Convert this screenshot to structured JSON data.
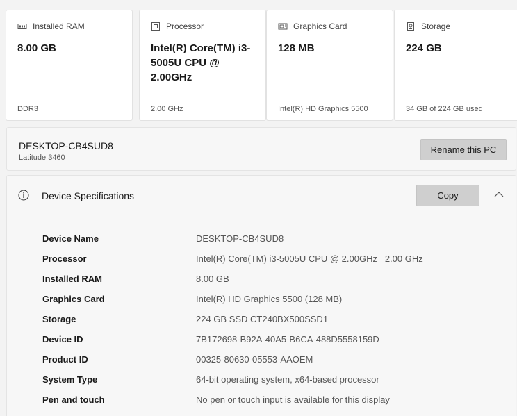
{
  "cards": [
    {
      "icon": "ram-icon",
      "label": "Installed RAM",
      "value": "8.00 GB",
      "sub": "DDR3"
    },
    {
      "icon": "processor-icon",
      "label": "Processor",
      "value": "Intel(R) Core(TM) i3-5005U CPU @ 2.00GHz",
      "sub": "2.00 GHz"
    },
    {
      "icon": "graphics-card-icon",
      "label": "Graphics Card",
      "value": "128 MB",
      "sub": "Intel(R) HD Graphics 5500"
    },
    {
      "icon": "storage-icon",
      "label": "Storage",
      "value": "224 GB",
      "sub": "34 GB of 224 GB used"
    }
  ],
  "device": {
    "name": "DESKTOP-CB4SUD8",
    "model": "Latitude 3460",
    "rename_label": "Rename this PC"
  },
  "specs": {
    "title": "Device Specifications",
    "copy_label": "Copy",
    "rows": [
      {
        "label": "Device Name",
        "value": "DESKTOP-CB4SUD8"
      },
      {
        "label": "Processor",
        "value": "Intel(R) Core(TM) i3-5005U CPU @ 2.00GHz   2.00 GHz"
      },
      {
        "label": "Installed RAM",
        "value": "8.00 GB"
      },
      {
        "label": "Graphics Card",
        "value": "Intel(R) HD Graphics 5500 (128 MB)"
      },
      {
        "label": "Storage",
        "value": "224 GB SSD CT240BX500SSD1"
      },
      {
        "label": "Device ID",
        "value": "7B172698-B92A-40A5-B6CA-488D5558159D"
      },
      {
        "label": "Product ID",
        "value": "00325-80630-05553-AAOEM"
      },
      {
        "label": "System Type",
        "value": "64-bit operating system, x64-based processor"
      },
      {
        "label": "Pen and touch",
        "value": "No pen or touch input is available for this display"
      }
    ]
  }
}
